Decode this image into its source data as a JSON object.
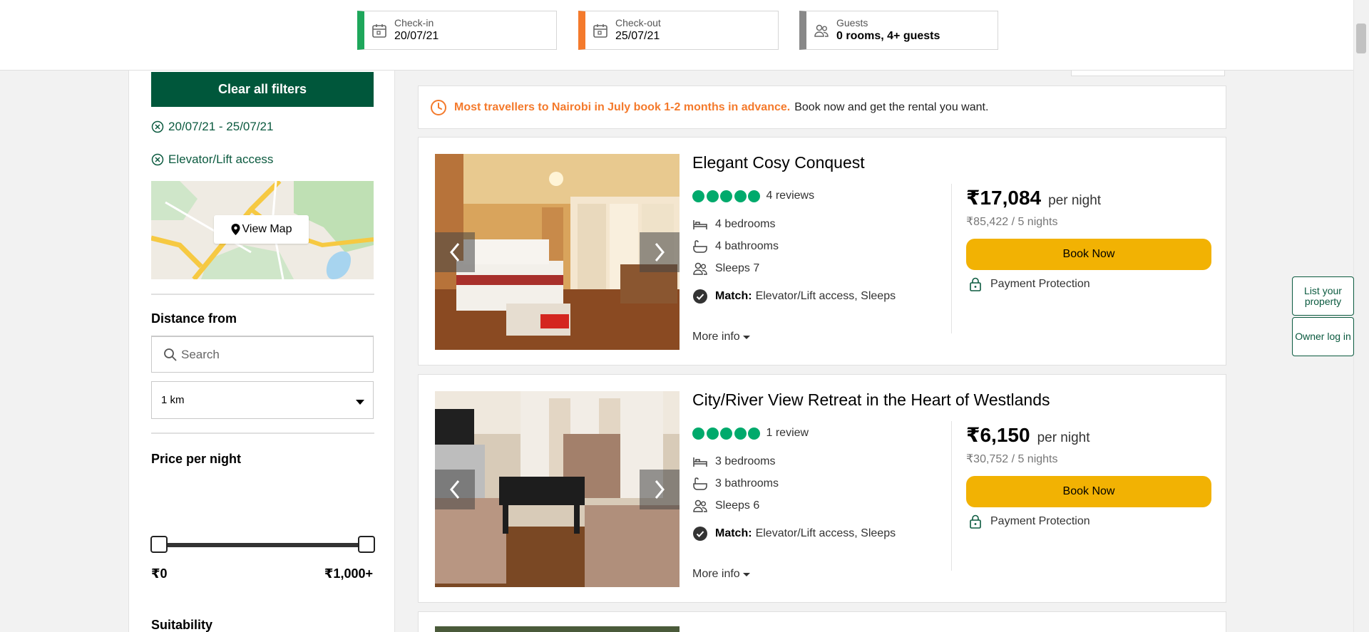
{
  "search_bar": {
    "checkin": {
      "label": "Check-in",
      "value": "20/07/21",
      "color": "#1ea75b"
    },
    "checkout": {
      "label": "Check-out",
      "value": "25/07/21",
      "color": "#f47a2c"
    },
    "guests": {
      "label": "Guests",
      "value": "0 rooms, 4+ guests",
      "color": "#888888"
    }
  },
  "filters": {
    "clear_label": "Clear all filters",
    "active": [
      "20/07/21 - 25/07/21",
      "Elevator/Lift access"
    ],
    "view_map_label": "View Map",
    "distance": {
      "title": "Distance from",
      "search_placeholder": "Search",
      "radius_selected": "1 km"
    },
    "price": {
      "title": "Price per night",
      "min_label": "₹0",
      "max_label": "₹1,000+",
      "range_fraction": [
        0,
        1
      ]
    },
    "suitability_title": "Suitability"
  },
  "notice": {
    "highlight": "Most travellers to Nairobi in July book 1-2 months in advance.",
    "rest": "Book now and get the rental you want."
  },
  "listings": [
    {
      "title": "Elegant Cosy Conquest",
      "rating_bubbles": 5,
      "reviews": "4 reviews",
      "bedrooms": "4 bedrooms",
      "bathrooms": "4 bathrooms",
      "sleeps": "Sleeps 7",
      "match_label": "Match:",
      "match_value": "Elevator/Lift access, Sleeps",
      "more_info": "More info",
      "price": "₹17,084",
      "per_night": "per night",
      "total": "₹85,422 / 5 nights",
      "book_label": "Book Now",
      "protection": "Payment Protection"
    },
    {
      "title": "City/River View Retreat in the Heart of Westlands",
      "rating_bubbles": 5,
      "reviews": "1 review",
      "bedrooms": "3 bedrooms",
      "bathrooms": "3 bathrooms",
      "sleeps": "Sleeps 6",
      "match_label": "Match:",
      "match_value": "Elevator/Lift access, Sleeps",
      "more_info": "More info",
      "price": "₹6,150",
      "per_night": "per night",
      "total": "₹30,752 / 5 nights",
      "book_label": "Book Now",
      "protection": "Payment Protection"
    }
  ],
  "owner_links": {
    "list_property": "List your property",
    "owner_login": "Owner log in"
  },
  "colors": {
    "brand_green": "#00573b",
    "rating_green": "#00aa6c",
    "book_yellow": "#f2b203",
    "notice_orange": "#f47a2c"
  }
}
